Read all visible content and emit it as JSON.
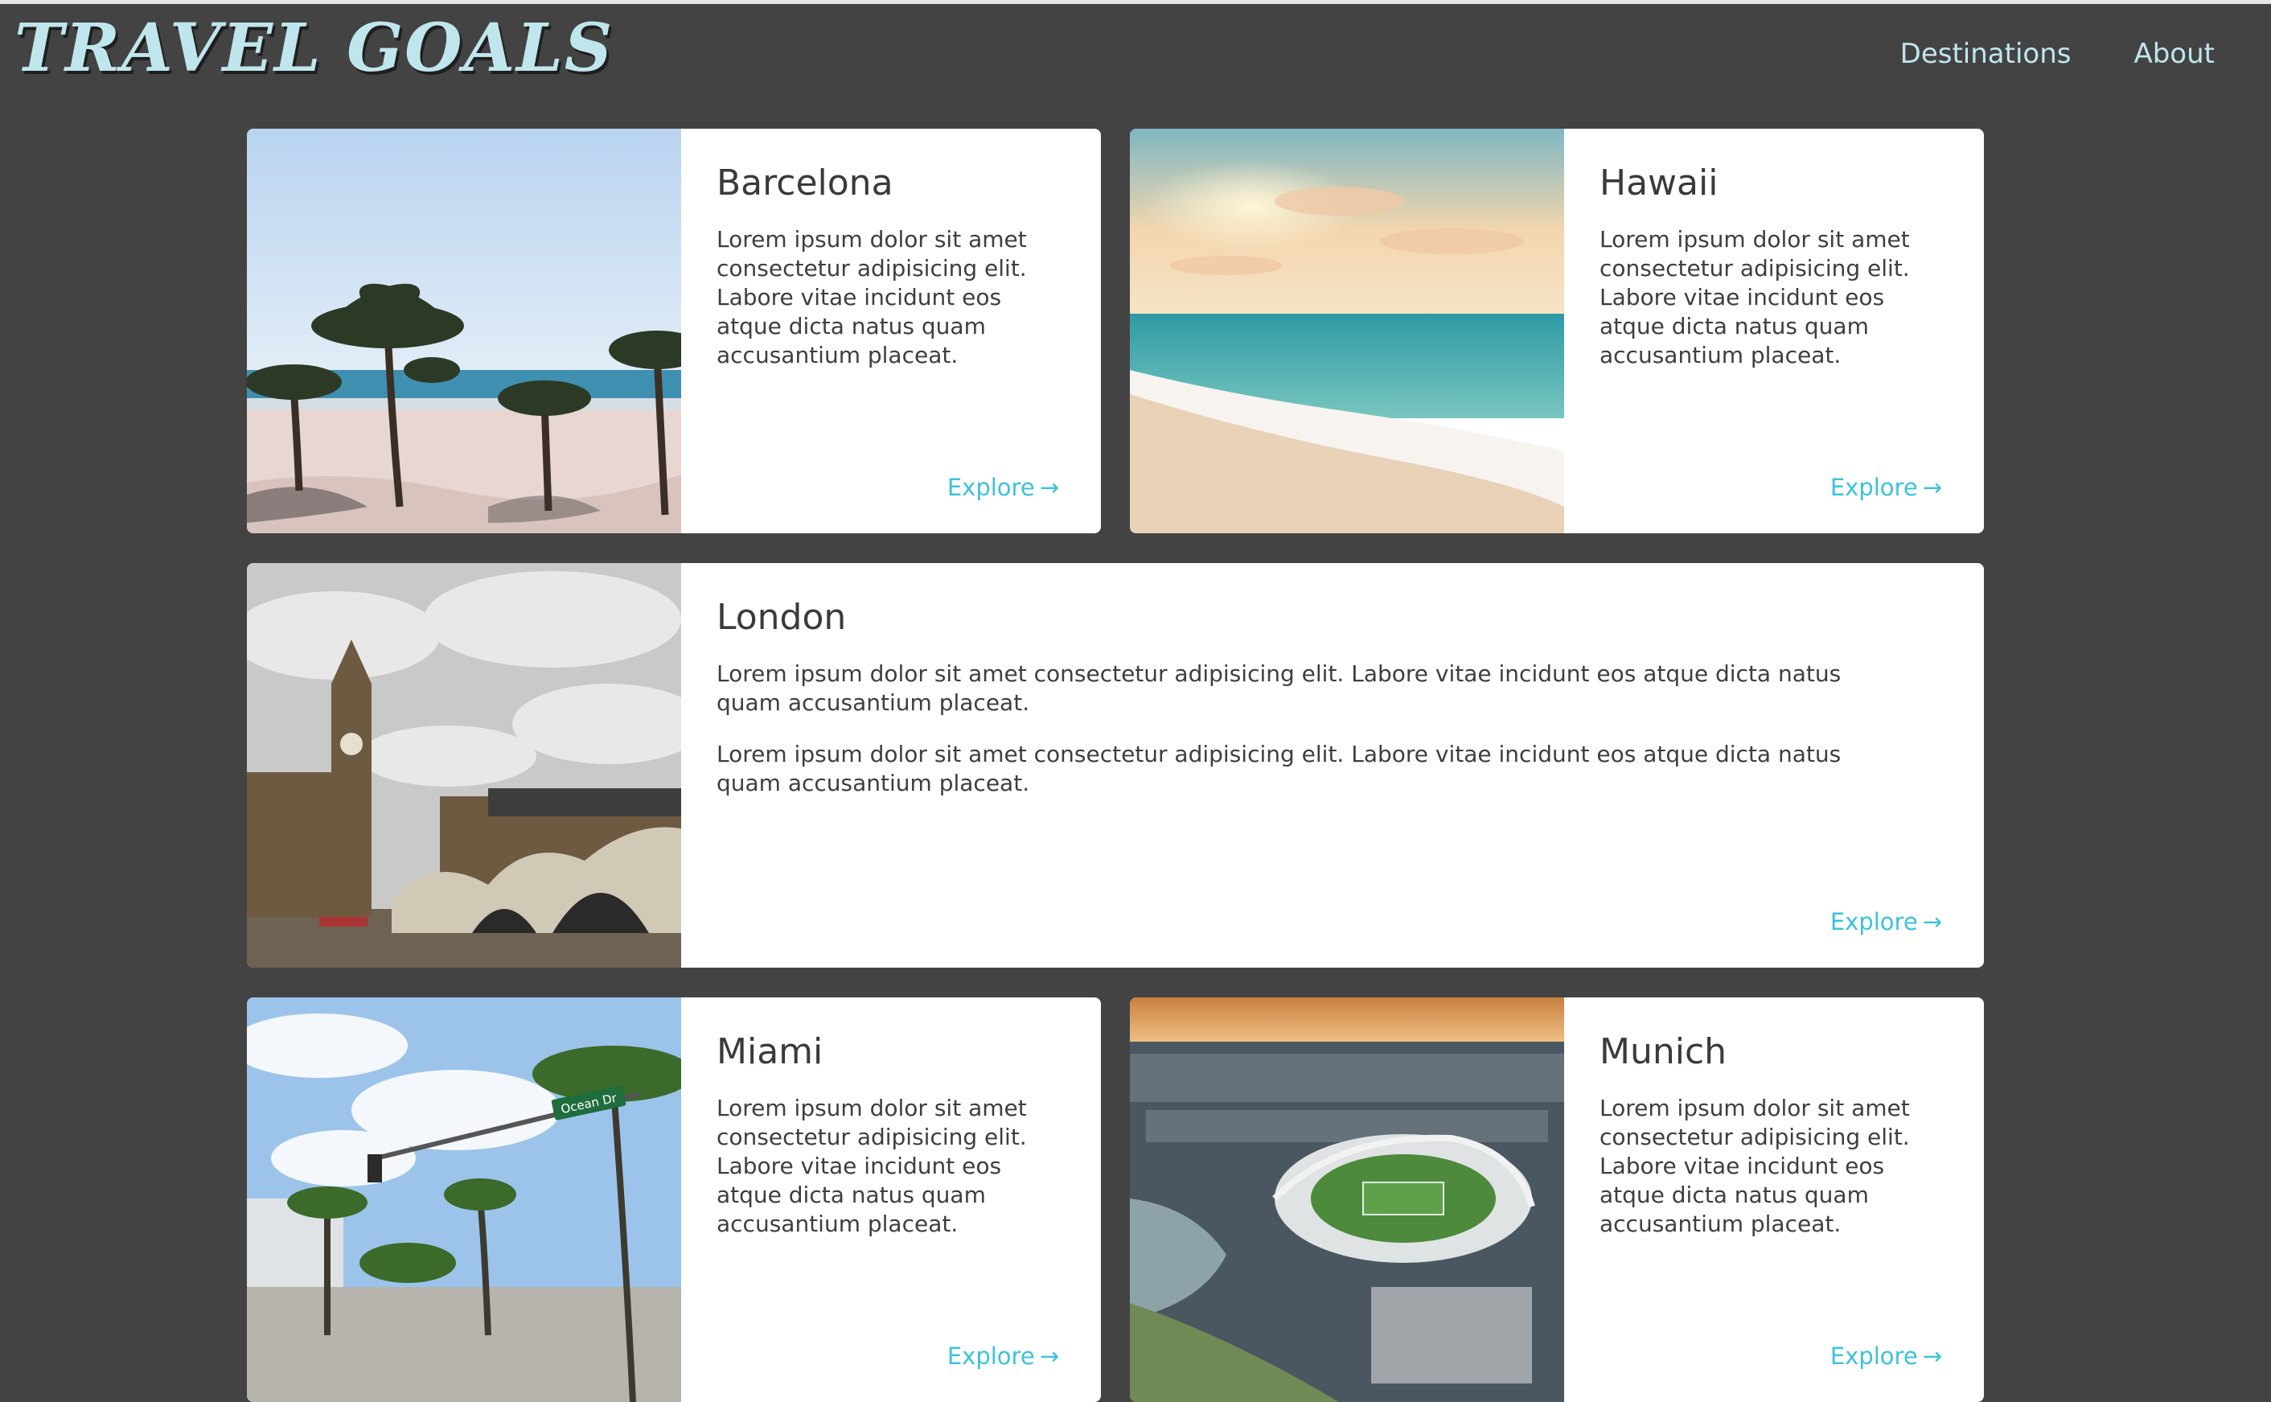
{
  "header": {
    "logo": "TRAVEL GOALS",
    "nav": [
      "Destinations",
      "About"
    ]
  },
  "accent_color": "#3cc3d9",
  "logo_color": "#bfe6ec",
  "background_color": "#434343",
  "cards": [
    {
      "title": "Barcelona",
      "paragraphs": [
        "Lorem ipsum dolor sit amet consectetur adipisicing elit. Labore vitae incidunt eos atque dicta natus quam accusantium placeat."
      ],
      "link": "Explore",
      "link_icon": "arrow-right-icon",
      "image": "palm-trees-beach-photo"
    },
    {
      "title": "Hawaii",
      "paragraphs": [
        "Lorem ipsum dolor sit amet consectetur adipisicing elit. Labore vitae incidunt eos atque dicta natus quam accusantium placeat."
      ],
      "link": "Explore",
      "link_icon": "arrow-right-icon",
      "image": "sunset-beach-photo"
    },
    {
      "title": "London",
      "paragraphs": [
        "Lorem ipsum dolor sit amet consectetur adipisicing elit. Labore vitae incidunt eos atque dicta natus quam accusantium placeat.",
        "Lorem ipsum dolor sit amet consectetur adipisicing elit. Labore vitae incidunt eos atque dicta natus quam accusantium placeat."
      ],
      "link": "Explore",
      "link_icon": "arrow-right-icon",
      "image": "big-ben-bridge-photo"
    },
    {
      "title": "Miami",
      "paragraphs": [
        "Lorem ipsum dolor sit amet consectetur adipisicing elit. Labore vitae incidunt eos atque dicta natus quam accusantium placeat."
      ],
      "link": "Explore",
      "link_icon": "arrow-right-icon",
      "image": "ocean-drive-street-photo",
      "image_sign": "Ocean Dr"
    },
    {
      "title": "Munich",
      "paragraphs": [
        "Lorem ipsum dolor sit amet consectetur adipisicing elit. Labore vitae incidunt eos atque dicta natus quam accusantium placeat."
      ],
      "link": "Explore",
      "link_icon": "arrow-right-icon",
      "image": "stadium-aerial-photo"
    }
  ]
}
